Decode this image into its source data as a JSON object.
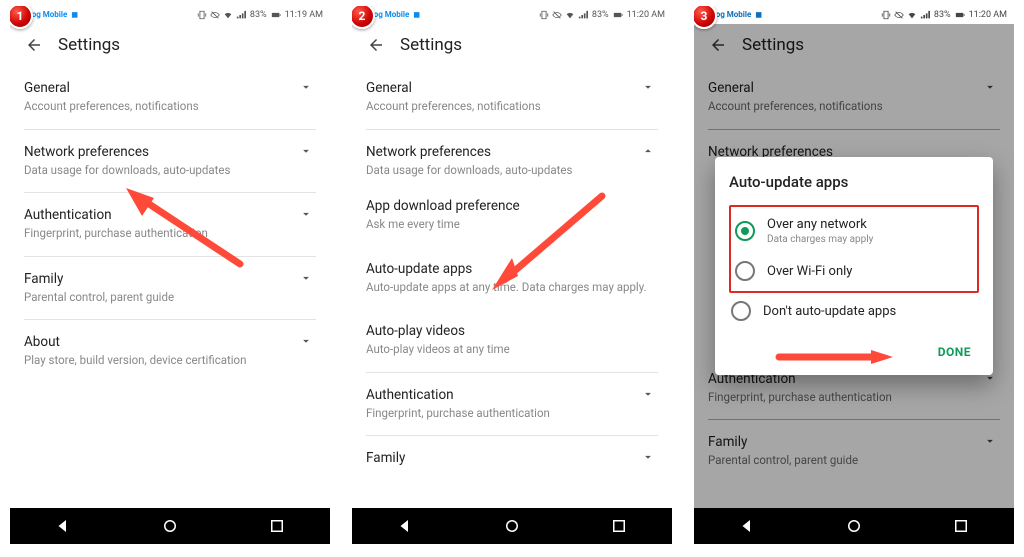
{
  "status": {
    "carrier": "Dialog Mobile",
    "battery_pct": "83%",
    "times": [
      "11:19 AM",
      "11:20 AM",
      "11:20 AM"
    ]
  },
  "appbar": {
    "title": "Settings"
  },
  "sections": {
    "general": {
      "title": "General",
      "sub": "Account preferences, notifications"
    },
    "network": {
      "title": "Network preferences",
      "sub": "Data usage for downloads, auto-updates"
    },
    "auth": {
      "title": "Authentication",
      "sub": "Fingerprint, purchase authentication"
    },
    "family": {
      "title": "Family",
      "sub": "Parental control, parent guide"
    },
    "about": {
      "title": "About",
      "sub": "Play store, build version, device certification"
    },
    "dlpref": {
      "title": "App download preference",
      "sub": "Ask me every time"
    },
    "autoapps": {
      "title": "Auto-update apps",
      "sub": "Auto-update apps at any time. Data charges may apply."
    },
    "autoplay": {
      "title": "Auto-play videos",
      "sub": "Auto-play videos at any time"
    }
  },
  "dialog": {
    "title": "Auto-update apps",
    "options": [
      {
        "label": "Over any network",
        "sub": "Data charges may apply",
        "selected": true
      },
      {
        "label": "Over Wi-Fi only",
        "sub": "",
        "selected": false
      },
      {
        "label": "Don't auto-update apps",
        "sub": "",
        "selected": false
      }
    ],
    "done": "DONE"
  },
  "step_badges": [
    "1",
    "2",
    "3"
  ]
}
